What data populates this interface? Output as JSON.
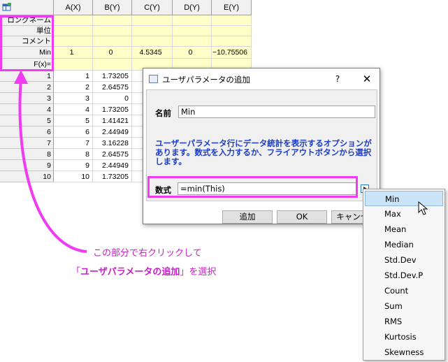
{
  "spreadsheet": {
    "columns": [
      "A(X)",
      "B(Y)",
      "C(Y)",
      "D(Y)",
      "E(Y)"
    ],
    "meta_rows": [
      "ロングネーム",
      "単位",
      "コメント",
      "Min",
      "F(x)="
    ],
    "min_row_values": [
      "1",
      "0",
      "4.5345",
      "0",
      "−10.75506"
    ],
    "row_numbers": [
      "1",
      "2",
      "3",
      "4",
      "5",
      "6",
      "7",
      "8",
      "9",
      "10"
    ],
    "col_a": [
      "1",
      "2",
      "3",
      "4",
      "5",
      "6",
      "7",
      "8",
      "9",
      "10"
    ],
    "col_b": [
      "1.73205",
      "2.64575",
      "0",
      "1.73205",
      "1.41421",
      "2.44949",
      "3.16228",
      "2.64575",
      "2.44949",
      "1.73205"
    ]
  },
  "dialog": {
    "title": "ユーザパラメータの追加",
    "help": "?",
    "close": "✕",
    "name_label": "名前",
    "name_value": "Min",
    "description": "ユーザーパラメータ行にデータ統計を表示するオプションがあります。数式を入力するか、フライアウトボタンから選択します。",
    "expr_label": "数式",
    "expr_value": "=min(This)",
    "add_button": "追加",
    "ok_button": "OK",
    "cancel_button": "キャンセル"
  },
  "menu": {
    "items": [
      "Min",
      "Max",
      "Mean",
      "Median",
      "Std.Dev",
      "Std.Dev.P",
      "Count",
      "Sum",
      "RMS",
      "Kurtosis",
      "Skewness"
    ],
    "selected": "Min"
  },
  "annotation": {
    "line1": "この部分で右クリックして",
    "line2_open": "「",
    "line2_bold": "ユーザパラメータの追加",
    "line2_close": "」を選択",
    "color": "#f03cf0"
  }
}
